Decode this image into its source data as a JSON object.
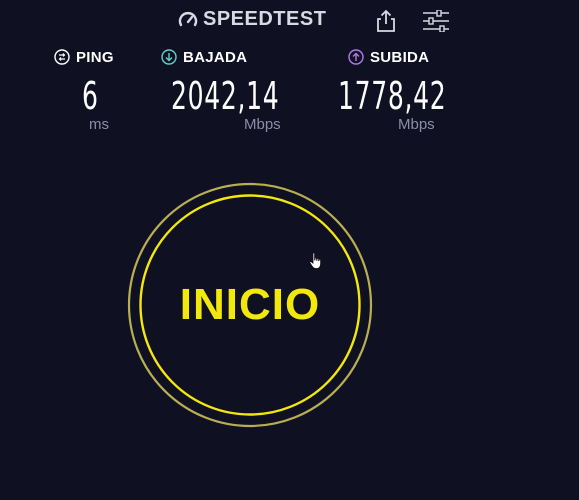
{
  "header": {
    "logo_text": "SPEEDTEST",
    "logo_icon": "speedometer-icon",
    "share_icon": "share-icon",
    "settings_icon": "sliders-icon"
  },
  "metrics": {
    "ping": {
      "label": "PING",
      "value": "6",
      "unit": "ms",
      "icon": "ping-icon",
      "icon_color": "#ffffff"
    },
    "download": {
      "label": "BAJADA",
      "value": "2042,14",
      "unit": "Mbps",
      "icon": "arrow-down-circle-icon",
      "icon_color": "#5fd3c4"
    },
    "upload": {
      "label": "SUBIDA",
      "value": "1778,42",
      "unit": "Mbps",
      "icon": "arrow-up-circle-icon",
      "icon_color": "#b07ce8"
    }
  },
  "start_button": {
    "label": "INICIO",
    "color": "#f2e80c"
  },
  "colors": {
    "background": "#0f1022",
    "accent": "#f2e80c",
    "muted_text": "#8c8da6"
  }
}
